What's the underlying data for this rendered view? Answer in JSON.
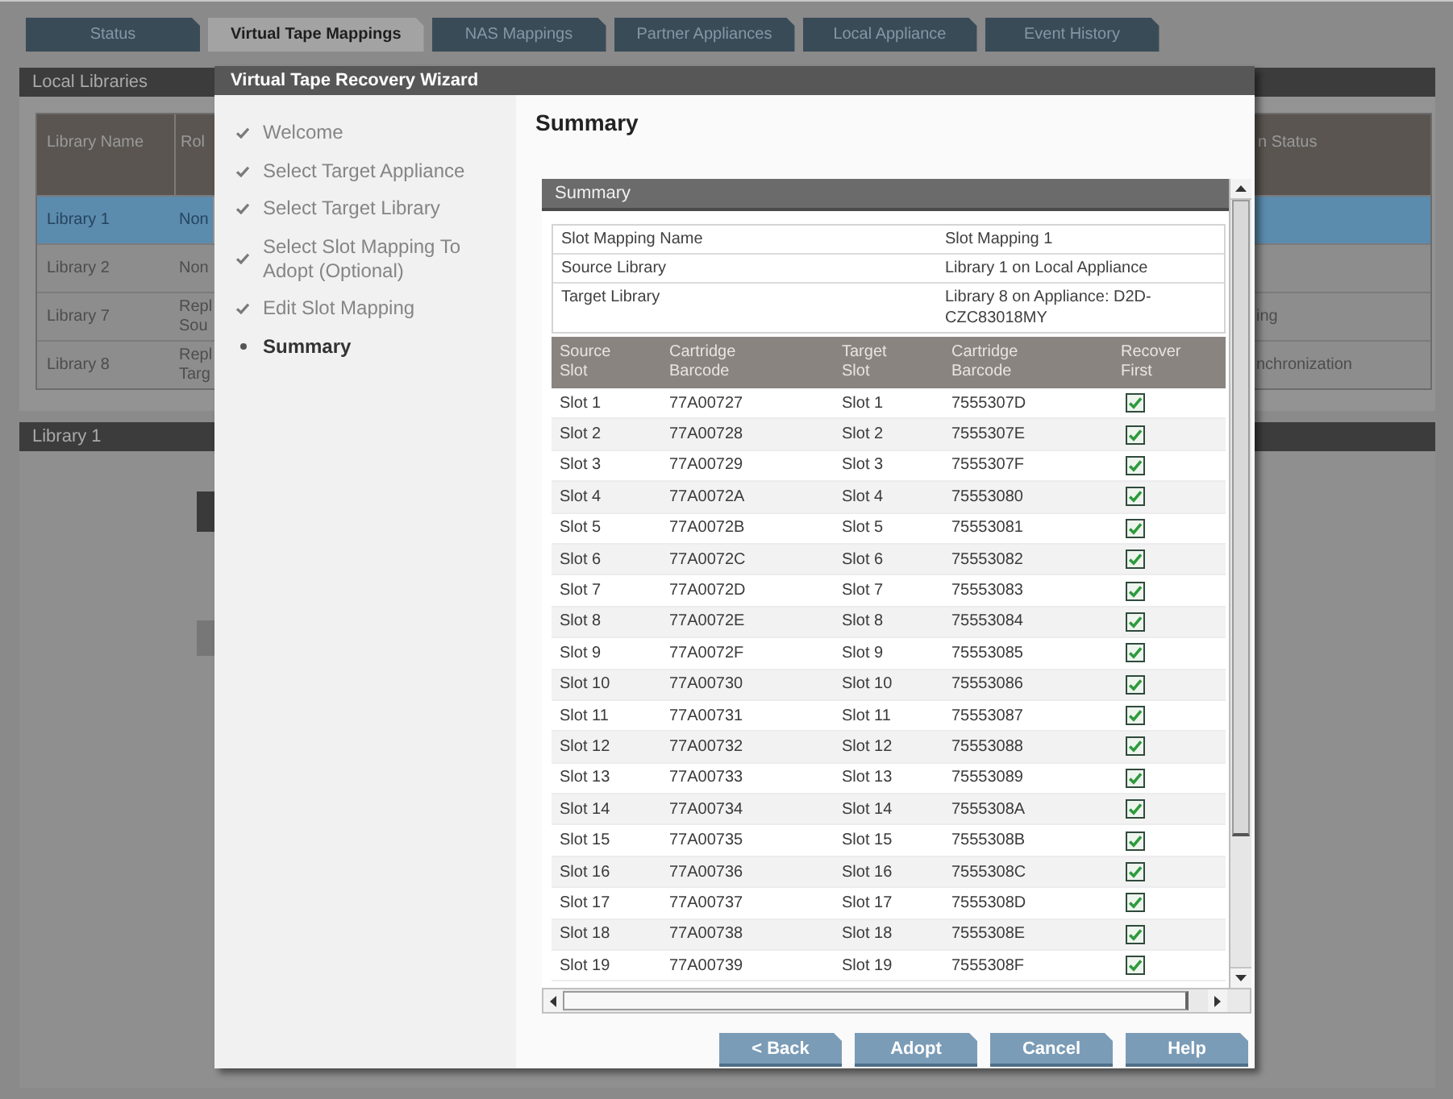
{
  "tabs": [
    {
      "label": "Status",
      "selected": false
    },
    {
      "label": "Virtual Tape Mappings",
      "selected": true
    },
    {
      "label": "NAS Mappings",
      "selected": false
    },
    {
      "label": "Partner Appliances",
      "selected": false
    },
    {
      "label": "Local Appliance",
      "selected": false
    },
    {
      "label": "Event History",
      "selected": false
    }
  ],
  "local_libraries": {
    "title": "Local Libraries",
    "columns": [
      "Library Name",
      "Rol",
      "n Status"
    ],
    "rows": [
      {
        "library_name": "Library 1",
        "column_2": [
          "Non"
        ],
        "selected": true
      },
      {
        "library_name": "Library 2",
        "column_2": [
          "Non"
        ],
        "selected": false
      },
      {
        "library_name": "Library 7",
        "column_2": [
          "Repl",
          "Sou"
        ],
        "column_3": "ing",
        "selected": false
      },
      {
        "library_name": "Library 8",
        "column_2": [
          "Repl",
          "Targ"
        ],
        "column_3": "nchronization",
        "selected": false
      }
    ]
  },
  "library_section": {
    "title": "Library 1"
  },
  "wizard": {
    "title": "Virtual Tape Recovery Wizard",
    "steps": [
      {
        "label": "Welcome",
        "selected": false
      },
      {
        "label": "Select Target Appliance",
        "selected": false
      },
      {
        "label": "Select Target Library",
        "selected": false
      },
      {
        "label": "Select Slot Mapping To Adopt (Optional)",
        "selected": false
      },
      {
        "label": "Edit Slot Mapping",
        "selected": false
      },
      {
        "label": "Summary",
        "selected": true
      }
    ],
    "heading": "Summary",
    "panel_title": "Summary",
    "details": [
      {
        "label": "Slot Mapping Name",
        "value": "Slot Mapping 1"
      },
      {
        "label": "Source Library",
        "value": "Library 1 on Local Appliance"
      },
      {
        "label": "Target Library",
        "value": "Library 8 on Appliance: D2D-CZC83018MY"
      }
    ],
    "slot_table": {
      "columns": [
        "Source Slot",
        "Cartridge Barcode",
        "Target Slot",
        "Cartridge Barcode",
        "Recover First"
      ],
      "rows": [
        {
          "source_slot": "Slot 1",
          "source_barcode": "77A00727",
          "target_slot": "Slot 1",
          "target_barcode": "7555307D",
          "recover_first": true
        },
        {
          "source_slot": "Slot 2",
          "source_barcode": "77A00728",
          "target_slot": "Slot 2",
          "target_barcode": "7555307E",
          "recover_first": true
        },
        {
          "source_slot": "Slot 3",
          "source_barcode": "77A00729",
          "target_slot": "Slot 3",
          "target_barcode": "7555307F",
          "recover_first": true
        },
        {
          "source_slot": "Slot 4",
          "source_barcode": "77A0072A",
          "target_slot": "Slot 4",
          "target_barcode": "75553080",
          "recover_first": true
        },
        {
          "source_slot": "Slot 5",
          "source_barcode": "77A0072B",
          "target_slot": "Slot 5",
          "target_barcode": "75553081",
          "recover_first": true
        },
        {
          "source_slot": "Slot 6",
          "source_barcode": "77A0072C",
          "target_slot": "Slot 6",
          "target_barcode": "75553082",
          "recover_first": true
        },
        {
          "source_slot": "Slot 7",
          "source_barcode": "77A0072D",
          "target_slot": "Slot 7",
          "target_barcode": "75553083",
          "recover_first": true
        },
        {
          "source_slot": "Slot 8",
          "source_barcode": "77A0072E",
          "target_slot": "Slot 8",
          "target_barcode": "75553084",
          "recover_first": true
        },
        {
          "source_slot": "Slot 9",
          "source_barcode": "77A0072F",
          "target_slot": "Slot 9",
          "target_barcode": "75553085",
          "recover_first": true
        },
        {
          "source_slot": "Slot 10",
          "source_barcode": "77A00730",
          "target_slot": "Slot 10",
          "target_barcode": "75553086",
          "recover_first": true
        },
        {
          "source_slot": "Slot 11",
          "source_barcode": "77A00731",
          "target_slot": "Slot 11",
          "target_barcode": "75553087",
          "recover_first": true
        },
        {
          "source_slot": "Slot 12",
          "source_barcode": "77A00732",
          "target_slot": "Slot 12",
          "target_barcode": "75553088",
          "recover_first": true
        },
        {
          "source_slot": "Slot 13",
          "source_barcode": "77A00733",
          "target_slot": "Slot 13",
          "target_barcode": "75553089",
          "recover_first": true
        },
        {
          "source_slot": "Slot 14",
          "source_barcode": "77A00734",
          "target_slot": "Slot 14",
          "target_barcode": "7555308A",
          "recover_first": true
        },
        {
          "source_slot": "Slot 15",
          "source_barcode": "77A00735",
          "target_slot": "Slot 15",
          "target_barcode": "7555308B",
          "recover_first": true
        },
        {
          "source_slot": "Slot 16",
          "source_barcode": "77A00736",
          "target_slot": "Slot 16",
          "target_barcode": "7555308C",
          "recover_first": true
        },
        {
          "source_slot": "Slot 17",
          "source_barcode": "77A00737",
          "target_slot": "Slot 17",
          "target_barcode": "7555308D",
          "recover_first": true
        },
        {
          "source_slot": "Slot 18",
          "source_barcode": "77A00738",
          "target_slot": "Slot 18",
          "target_barcode": "7555308E",
          "recover_first": true
        },
        {
          "source_slot": "Slot 19",
          "source_barcode": "77A00739",
          "target_slot": "Slot 19",
          "target_barcode": "7555308F",
          "recover_first": true
        }
      ]
    },
    "buttons": [
      "< Back",
      "Adopt",
      "Cancel",
      "Help"
    ]
  }
}
